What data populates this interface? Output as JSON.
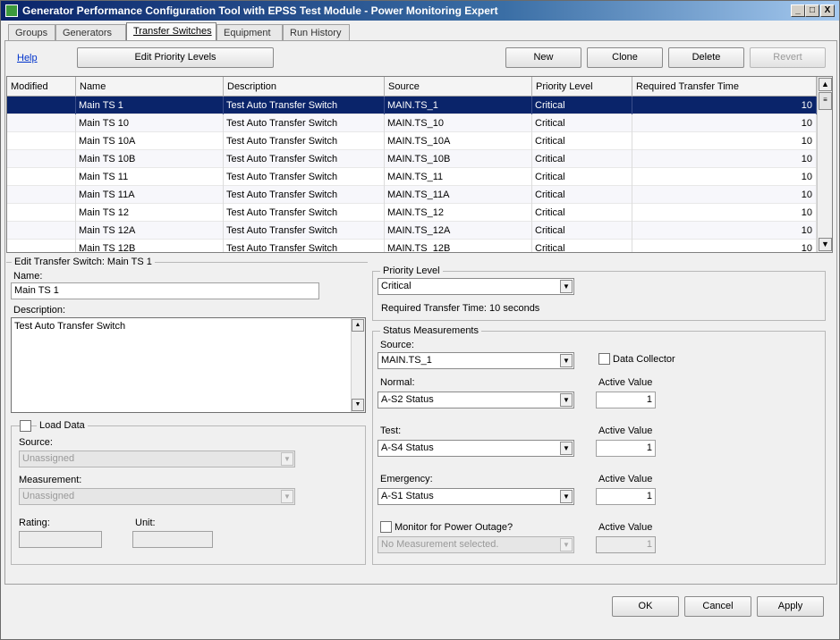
{
  "window": {
    "title": "Generator Performance Configuration Tool with EPSS Test Module - Power Monitoring Expert",
    "icon": "app-icon",
    "controls": {
      "minimize": "_",
      "maximize": "□",
      "close": "X"
    }
  },
  "tabs": [
    {
      "label": "Groups"
    },
    {
      "label": "Generators"
    },
    {
      "label": "Transfer Switches",
      "active": true
    },
    {
      "label": "Equipment"
    },
    {
      "label": "Run History"
    }
  ],
  "toolbar": {
    "help": "Help",
    "edit_priority_levels": "Edit Priority Levels",
    "new": "New",
    "clone": "Clone",
    "delete": "Delete",
    "revert": "Revert"
  },
  "grid": {
    "columns": [
      "Modified",
      "Name",
      "Description",
      "Source",
      "Priority Level",
      "Required Transfer Time"
    ],
    "rows": [
      {
        "modified": "",
        "name": "Main TS 1",
        "description": "Test Auto Transfer Switch",
        "source": "MAIN.TS_1",
        "priority": "Critical",
        "time": "10",
        "selected": true
      },
      {
        "modified": "",
        "name": "Main TS 10",
        "description": "Test Auto Transfer Switch",
        "source": "MAIN.TS_10",
        "priority": "Critical",
        "time": "10"
      },
      {
        "modified": "",
        "name": "Main TS 10A",
        "description": "Test Auto Transfer Switch",
        "source": "MAIN.TS_10A",
        "priority": "Critical",
        "time": "10"
      },
      {
        "modified": "",
        "name": "Main TS 10B",
        "description": "Test Auto Transfer Switch",
        "source": "MAIN.TS_10B",
        "priority": "Critical",
        "time": "10"
      },
      {
        "modified": "",
        "name": "Main TS 11",
        "description": "Test Auto Transfer Switch",
        "source": "MAIN.TS_11",
        "priority": "Critical",
        "time": "10"
      },
      {
        "modified": "",
        "name": "Main TS 11A",
        "description": "Test Auto Transfer Switch",
        "source": "MAIN.TS_11A",
        "priority": "Critical",
        "time": "10"
      },
      {
        "modified": "",
        "name": "Main TS 12",
        "description": "Test Auto Transfer Switch",
        "source": "MAIN.TS_12",
        "priority": "Critical",
        "time": "10"
      },
      {
        "modified": "",
        "name": "Main TS 12A",
        "description": "Test Auto Transfer Switch",
        "source": "MAIN.TS_12A",
        "priority": "Critical",
        "time": "10"
      },
      {
        "modified": "",
        "name": "Main TS 12B",
        "description": "Test Auto Transfer Switch",
        "source": "MAIN.TS_12B",
        "priority": "Critical",
        "time": "10"
      }
    ]
  },
  "edit": {
    "header": "Edit Transfer Switch: Main TS 1",
    "name_label": "Name:",
    "name_value": "Main TS 1",
    "description_label": "Description:",
    "description_value": "Test Auto Transfer Switch",
    "load_data": {
      "legend": "Load Data",
      "source_label": "Source:",
      "source_value": "Unassigned",
      "measurement_label": "Measurement:",
      "measurement_value": "Unassigned",
      "rating_label": "Rating:",
      "rating_value": "",
      "unit_label": "Unit:",
      "unit_value": ""
    }
  },
  "priority": {
    "legend": "Priority Level",
    "value": "Critical",
    "required_time_text": "Required Transfer Time: 10 seconds"
  },
  "status": {
    "legend": "Status Measurements",
    "source_label": "Source:",
    "source_value": "MAIN.TS_1",
    "data_collector_label": "Data Collector",
    "normal_label": "Normal:",
    "normal_value": "A-S2 Status",
    "normal_active_label": "Active Value",
    "normal_active_value": "1",
    "test_label": "Test:",
    "test_value": "A-S4 Status",
    "test_active_label": "Active Value",
    "test_active_value": "1",
    "emergency_label": "Emergency:",
    "emergency_value": "A-S1 Status",
    "emergency_active_label": "Active Value",
    "emergency_active_value": "1",
    "outage_label": "Monitor for Power Outage?",
    "outage_value": "No Measurement selected.",
    "outage_active_label": "Active Value",
    "outage_active_value": "1"
  },
  "footer": {
    "ok": "OK",
    "cancel": "Cancel",
    "apply": "Apply"
  },
  "colors": {
    "selection": "#0a246a",
    "link": "#0033cc",
    "title_start": "#0a246a"
  }
}
